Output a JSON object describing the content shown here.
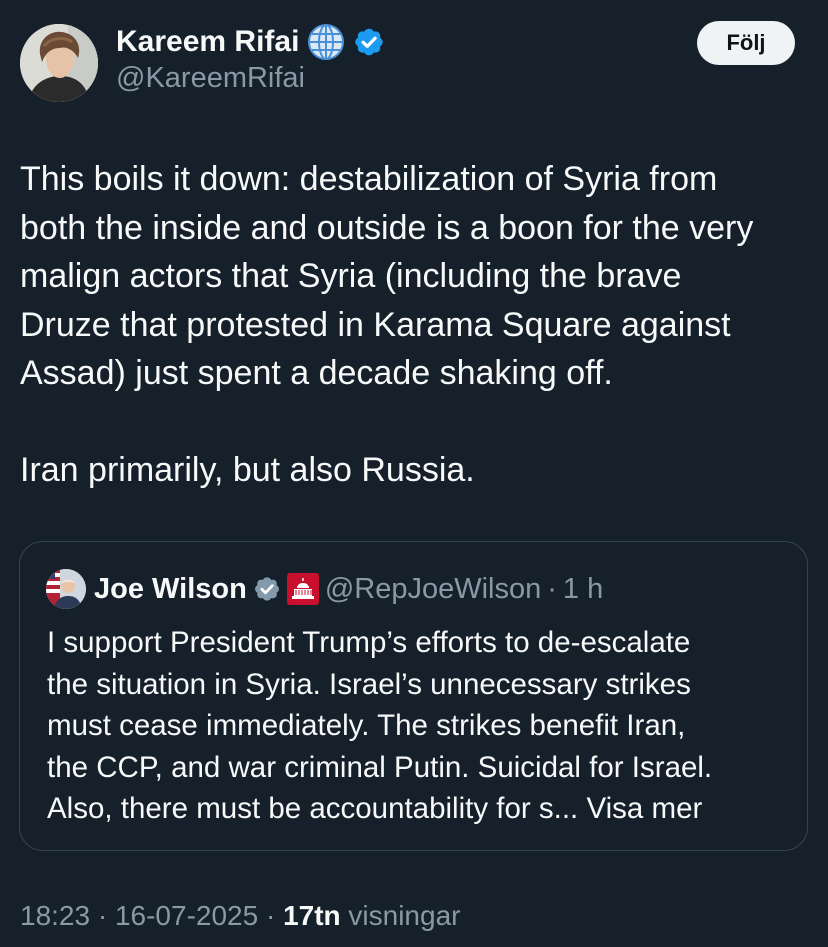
{
  "author": {
    "name": "Kareem Rifai",
    "handle": "@KareemRifai",
    "badges": [
      "globe-icon",
      "verified-badge-icon"
    ]
  },
  "follow_label": "Följ",
  "tweet": {
    "lines": [
      "This boils it down: destabilization of Syria from",
      "both the inside and outside is a boon for the very",
      "malign actors that Syria (including the brave",
      "Druze that protested in Karama Square against",
      "Assad) just spent a decade shaking off."
    ],
    "second_paragraph": "Iran primarily, but also Russia."
  },
  "quote": {
    "name": "Joe Wilson",
    "handle": "@RepJoeWilson",
    "separator": "·",
    "time": "1 h",
    "badges": [
      "gray-verified-badge-icon",
      "us-capitol-icon"
    ],
    "lines": [
      "I support President Trump’s efforts to de-escalate",
      "the situation in Syria. Israel’s unnecessary strikes",
      "must cease immediately. The strikes benefit Iran,",
      "the CCP, and war criminal Putin. Suicidal for Israel.",
      "Also, there must be accountability for s..."
    ],
    "show_more": "Visa mer"
  },
  "meta": {
    "timestamp": "18:23 · 16-07-2025 ·",
    "views_count": "17tn",
    "views_label": "visningar"
  },
  "colors": {
    "background": "#15202b",
    "text_primary": "#f7f9f9",
    "text_secondary": "#8b98a5",
    "verified_blue": "#1d9bf0",
    "verified_gray": "#829aab",
    "border": "#38444d",
    "follow_button_bg": "#eff3f4"
  }
}
